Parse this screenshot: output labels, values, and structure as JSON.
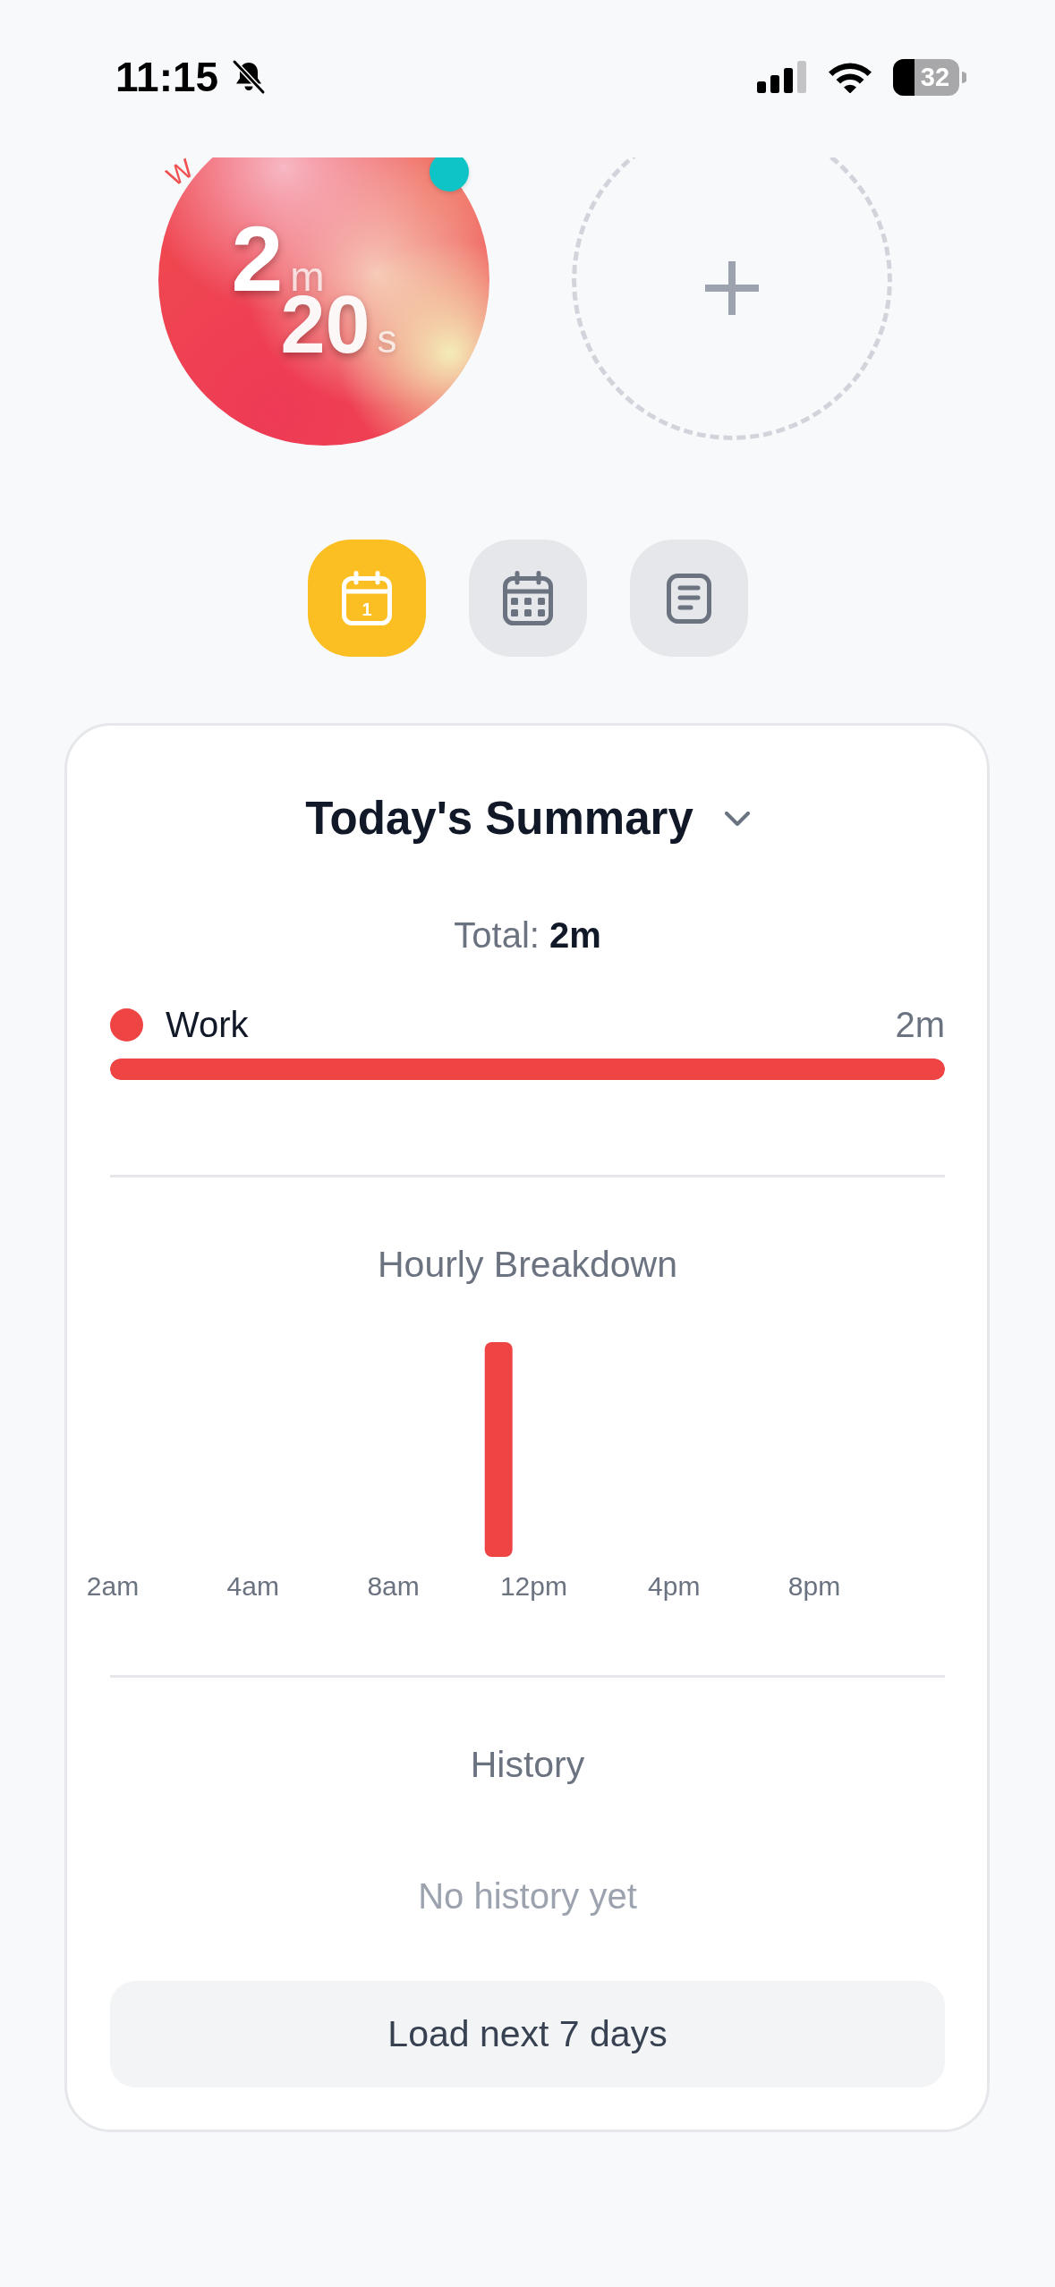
{
  "status_bar": {
    "time": "11:15",
    "battery": "32"
  },
  "timers": [
    {
      "kind": "timer",
      "label": "W",
      "minutes": "2",
      "minutes_unit": "m",
      "seconds": "20",
      "seconds_unit": "s"
    },
    {
      "kind": "add"
    }
  ],
  "view_tabs": [
    {
      "kind": "day",
      "badge": "1",
      "selected": true
    },
    {
      "kind": "month",
      "selected": false
    },
    {
      "kind": "notes",
      "selected": false
    }
  ],
  "summary": {
    "title": "Today's Summary",
    "total_label": "Total:",
    "total_value": "2m",
    "categories": [
      {
        "name": "Work",
        "value": "2m",
        "color": "#ef4444",
        "level": 1
      }
    ],
    "hourly": {
      "title": "Hourly Breakdown",
      "labels": [
        "2am",
        "4am",
        "8am",
        "12pm",
        "4pm",
        "8pm"
      ]
    },
    "history": {
      "title": "History",
      "empty_text": "No history yet",
      "button": "Load next 7 days"
    }
  }
}
